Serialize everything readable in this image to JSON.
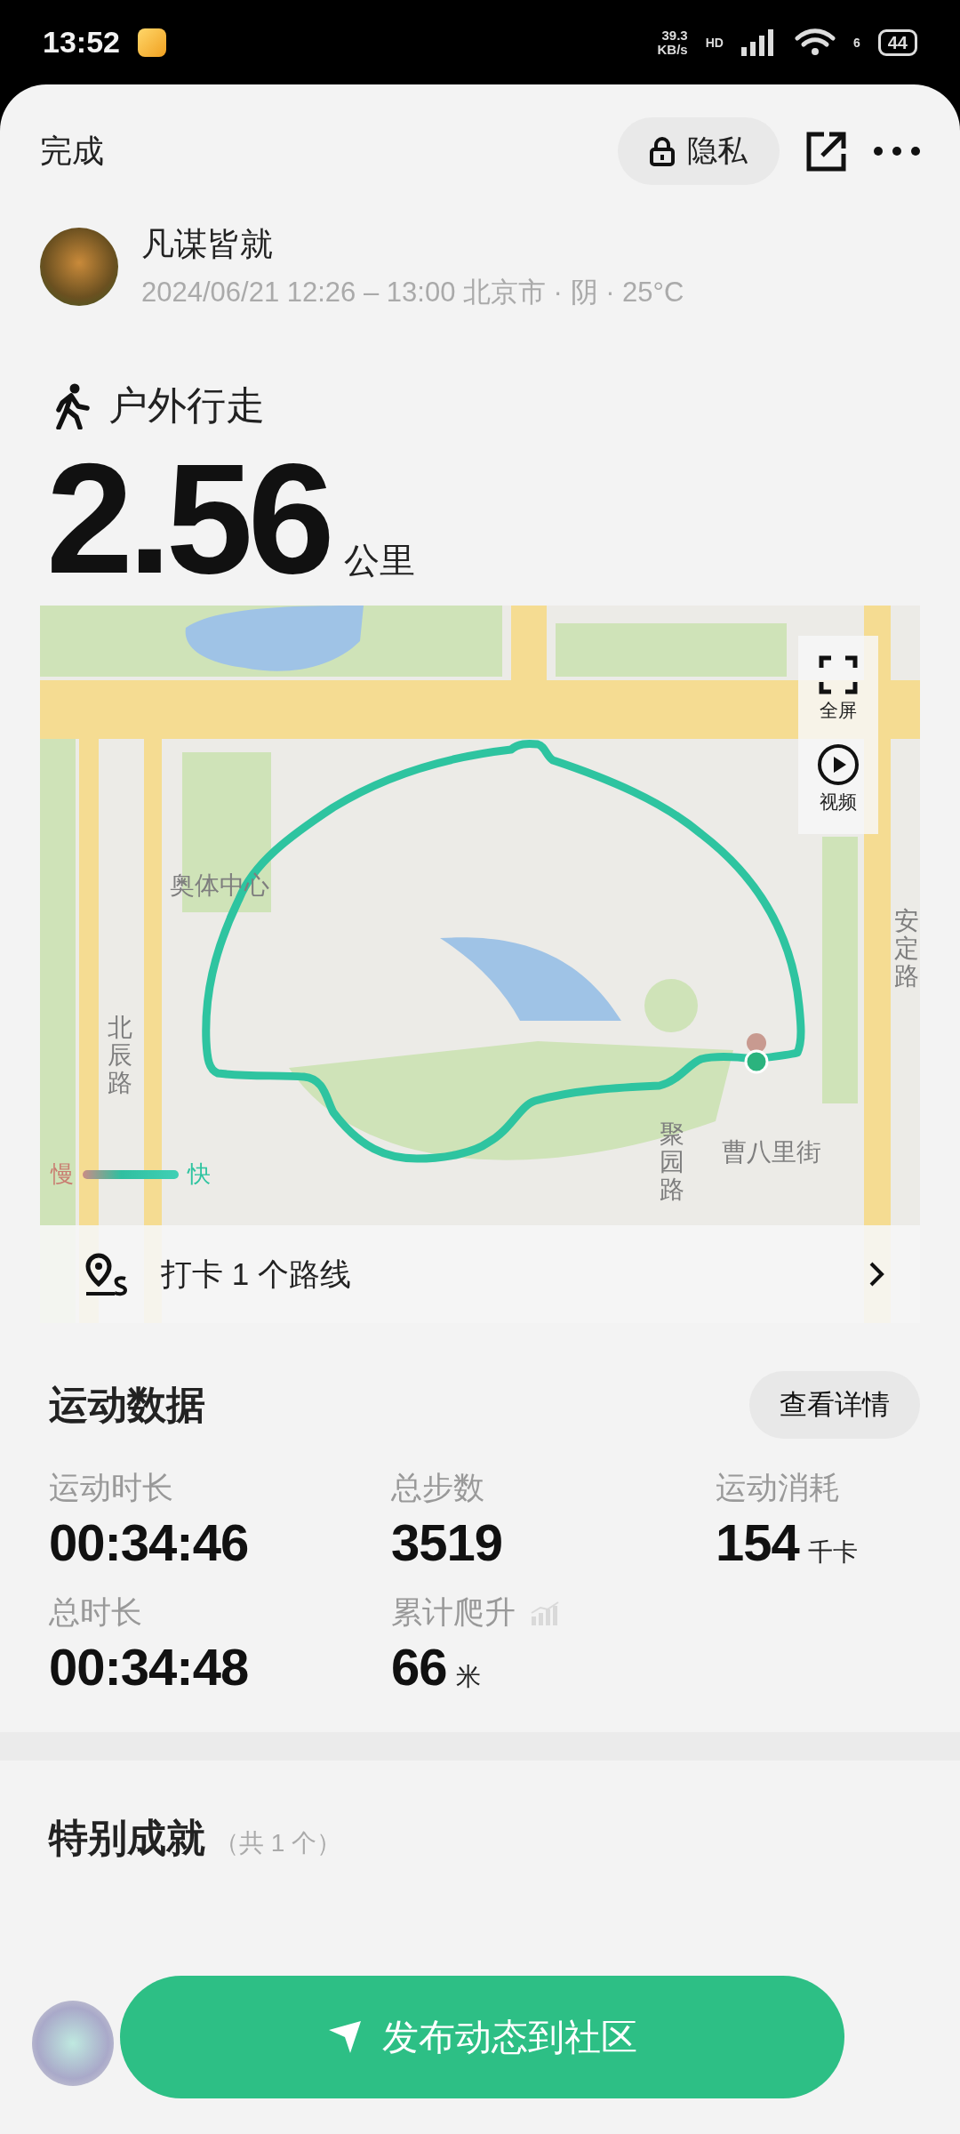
{
  "status_bar": {
    "time": "13:52",
    "network_speed": "39.3",
    "network_unit": "KB/s",
    "network_type": "HD",
    "wifi_badge": "6",
    "battery": "44"
  },
  "header": {
    "done": "完成",
    "privacy": "隐私"
  },
  "profile": {
    "name": "凡谋皆就",
    "meta": "2024/06/21 12:26 – 13:00 北京市 · 阴 · 25°C"
  },
  "activity": {
    "type": "户外行走",
    "distance": "2.56",
    "unit": "公里"
  },
  "map": {
    "labels": [
      {
        "text": "奥体中心",
        "vertical": false
      },
      {
        "text": "北辰路",
        "vertical": true
      },
      {
        "text": "安定路",
        "vertical": true
      },
      {
        "text": "曹八里街",
        "vertical": false
      },
      {
        "text": "聚园路",
        "vertical": true
      }
    ],
    "controls": [
      {
        "kind": "fullscreen",
        "label": "全屏"
      },
      {
        "kind": "video",
        "label": "视频"
      }
    ],
    "legend": {
      "slow": "慢",
      "fast": "快"
    },
    "route_link": "打卡 1 个路线"
  },
  "stats": {
    "title": "运动数据",
    "details_button": "查看详情",
    "items": [
      {
        "label": "运动时长",
        "value": "00:34:46"
      },
      {
        "label": "总步数",
        "value": "3519"
      },
      {
        "label": "运动消耗",
        "value": "154",
        "unit": "千卡"
      },
      {
        "label": "总时长",
        "value": "00:34:48"
      },
      {
        "label": "累计爬升",
        "value": "66",
        "unit": "米",
        "chart_icon": true
      }
    ]
  },
  "achievements": {
    "title": "特别成就",
    "count": "（共 1 个）"
  },
  "publish_button": "发布动态到社区"
}
